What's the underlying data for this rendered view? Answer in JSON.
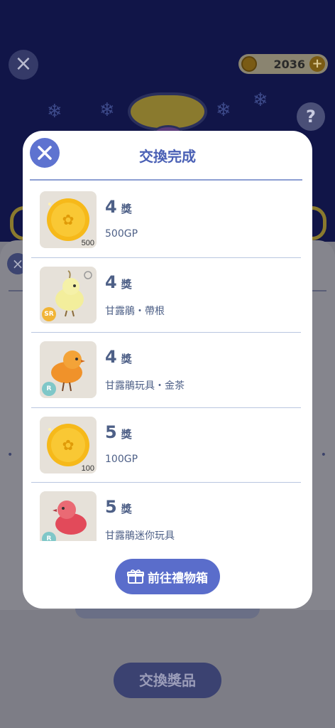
{
  "background": {
    "coin_amount": "2036",
    "help_label": "?",
    "action_label": "交換獎品"
  },
  "modal": {
    "title": "交換完成",
    "go_button_label": "前往禮物箱",
    "rewards": [
      {
        "count": "4",
        "unit": "獎",
        "name": "500GP",
        "badge": "500",
        "kind": "coin"
      },
      {
        "count": "4",
        "unit": "獎",
        "name": "甘露鵑・帶根",
        "badge": "SR",
        "kind": "bird-yellow"
      },
      {
        "count": "4",
        "unit": "獎",
        "name": "甘露鵑玩具・金茶",
        "badge": "R",
        "kind": "bird-orange"
      },
      {
        "count": "5",
        "unit": "獎",
        "name": "100GP",
        "badge": "100",
        "kind": "coin"
      },
      {
        "count": "5",
        "unit": "獎",
        "name": "甘露鵑迷你玩具",
        "badge": "R",
        "kind": "bird-red"
      }
    ]
  },
  "colors": {
    "accent": "#5a6dcb",
    "title": "#4a60b5",
    "text": "#4e6087",
    "sr_badge": "#f1b436",
    "r_badge": "#7fc7c8"
  }
}
